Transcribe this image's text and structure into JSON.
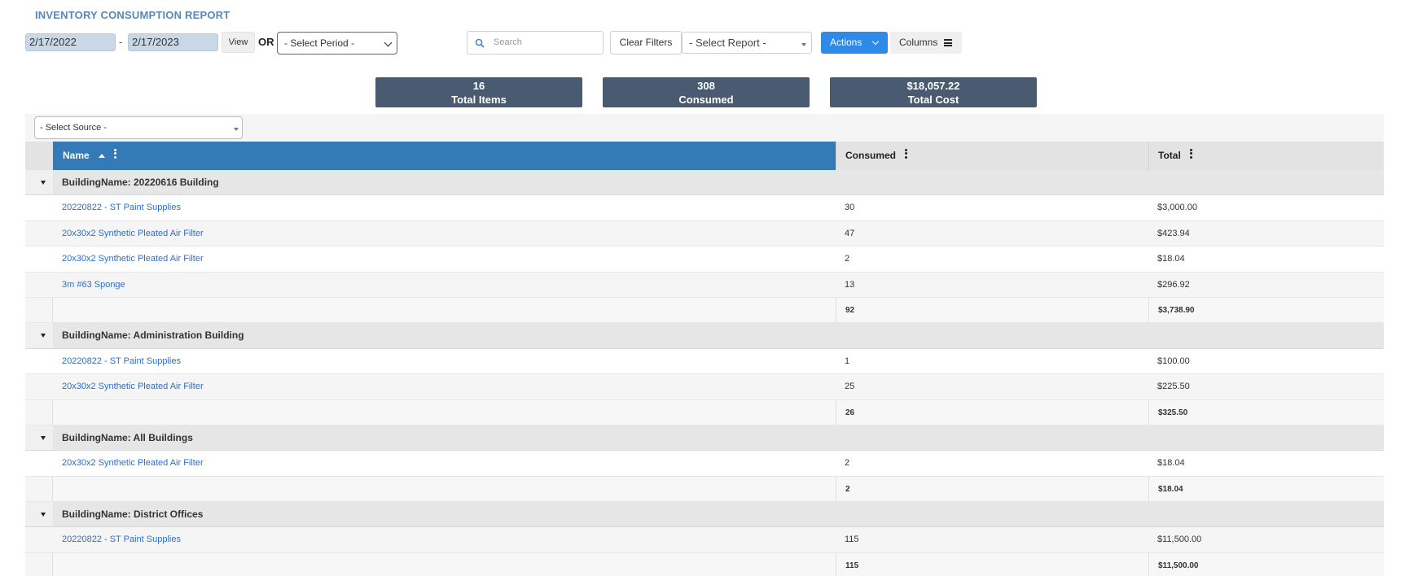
{
  "report": {
    "title": "INVENTORY CONSUMPTION REPORT"
  },
  "toolbar": {
    "date_from": "2/17/2022",
    "date_separator": "-",
    "date_to": "2/17/2023",
    "view_label": "View",
    "or_label": "OR",
    "period_select": "- Select Period -",
    "search_placeholder": "Search",
    "clear_filters_label": "Clear Filters",
    "report_select": "- Select Report -",
    "actions_label": "Actions",
    "columns_label": "Columns"
  },
  "stats": [
    {
      "value": "16",
      "label": "Total Items"
    },
    {
      "value": "308",
      "label": "Consumed"
    },
    {
      "value": "$18,057.22",
      "label": "Total Cost"
    }
  ],
  "source_select": "- Select Source -",
  "grid": {
    "columns": {
      "name": "Name",
      "consumed": "Consumed",
      "total": "Total"
    },
    "groups": [
      {
        "label": "BuildingName: 20220616 Building",
        "rows": [
          {
            "name": "20220822 - ST Paint Supplies",
            "consumed": "30",
            "total": "$3,000.00"
          },
          {
            "name": "20x30x2 Synthetic Pleated Air Filter",
            "consumed": "47",
            "total": "$423.94"
          },
          {
            "name": "20x30x2 Synthetic Pleated Air Filter",
            "consumed": "2",
            "total": "$18.04"
          },
          {
            "name": "3m #63 Sponge",
            "consumed": "13",
            "total": "$296.92"
          }
        ],
        "sum_consumed": "92",
        "sum_total": "$3,738.90"
      },
      {
        "label": "BuildingName: Administration Building",
        "rows": [
          {
            "name": "20220822 - ST Paint Supplies",
            "consumed": "1",
            "total": "$100.00"
          },
          {
            "name": "20x30x2 Synthetic Pleated Air Filter",
            "consumed": "25",
            "total": "$225.50"
          }
        ],
        "sum_consumed": "26",
        "sum_total": "$325.50"
      },
      {
        "label": "BuildingName: All Buildings",
        "rows": [
          {
            "name": "20x30x2 Synthetic Pleated Air Filter",
            "consumed": "2",
            "total": "$18.04"
          }
        ],
        "sum_consumed": "2",
        "sum_total": "$18.04"
      },
      {
        "label": "BuildingName: District Offices",
        "rows": [
          {
            "name": "20220822 - ST Paint Supplies",
            "consumed": "115",
            "total": "$11,500.00"
          }
        ],
        "sum_consumed": "115",
        "sum_total": "$11,500.00"
      }
    ]
  },
  "colors": {
    "accent": "#2d8ae8",
    "header_blue": "#337ab7",
    "stat_bg": "#4a5b71",
    "link": "#2d6fc9",
    "title": "#5b86b5"
  }
}
